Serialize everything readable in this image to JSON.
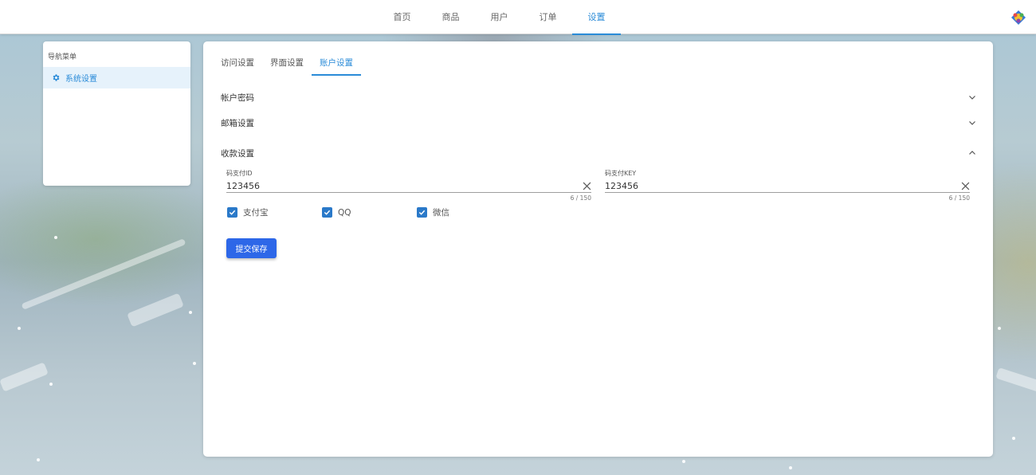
{
  "nav": {
    "items": [
      {
        "label": "首页"
      },
      {
        "label": "商品"
      },
      {
        "label": "用户"
      },
      {
        "label": "订单"
      },
      {
        "label": "设置"
      }
    ],
    "active_index": 4
  },
  "sidebar": {
    "title": "导航菜单",
    "items": [
      {
        "label": "系统设置",
        "icon": "gear-icon"
      }
    ]
  },
  "tabs": [
    {
      "label": "访问设置"
    },
    {
      "label": "界面设置"
    },
    {
      "label": "账户设置"
    }
  ],
  "active_tab_index": 2,
  "sections": {
    "account_password": {
      "title": "帐户密码",
      "expanded": false
    },
    "email_settings": {
      "title": "邮箱设置",
      "expanded": false
    },
    "payment_settings": {
      "title": "收款设置",
      "expanded": true
    }
  },
  "payment": {
    "id_field": {
      "label": "码支付ID",
      "value": "123456",
      "counter": "6 / 150"
    },
    "key_field": {
      "label": "码支付KEY",
      "value": "123456",
      "counter": "6 / 150"
    },
    "methods": [
      {
        "label": "支付宝",
        "checked": true
      },
      {
        "label": "QQ",
        "checked": true
      },
      {
        "label": "微信",
        "checked": true
      }
    ],
    "submit_label": "提交保存"
  },
  "colors": {
    "accent": "#2a8bd8",
    "button": "#2d67e8",
    "checkbox": "#2a79c9"
  }
}
